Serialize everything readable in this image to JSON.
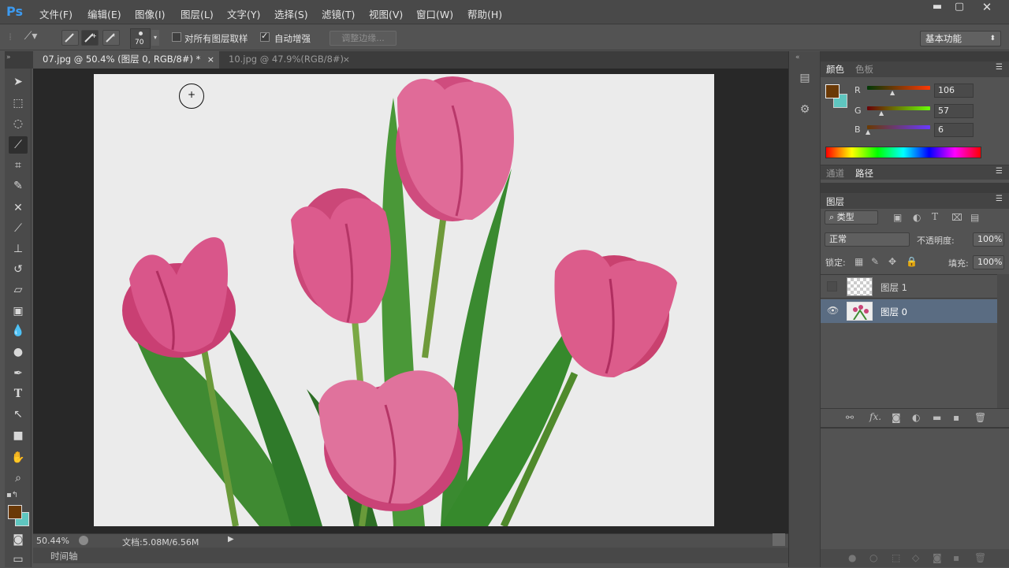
{
  "app": {
    "logo": "Ps"
  },
  "menu": [
    "文件(F)",
    "编辑(E)",
    "图像(I)",
    "图层(L)",
    "文字(Y)",
    "选择(S)",
    "滤镜(T)",
    "视图(V)",
    "窗口(W)",
    "帮助(H)"
  ],
  "options": {
    "brush_size": "70",
    "sample_all_layers": "对所有图层取样",
    "auto_enhance": "自动增强",
    "refine_edge": "调整边缘...",
    "workspace": "基本功能"
  },
  "tabs": [
    {
      "label": "07.jpg @ 50.4% (图层 0, RGB/8#) *",
      "close": "×"
    },
    {
      "label": "10.jpg @ 47.9%(RGB/8#)",
      "close": "×"
    }
  ],
  "status": {
    "zoom": "50.44%",
    "doc": "文档:5.08M/6.56M",
    "timeline": "时间轴"
  },
  "color_panel": {
    "tabs": [
      "颜色",
      "色板"
    ],
    "r_label": "R",
    "g_label": "G",
    "b_label": "B",
    "r": "106",
    "g": "57",
    "b": "6",
    "fg": "#6a3906",
    "bg": "#5fc6c0"
  },
  "paths_panel": {
    "tabs": [
      "通道",
      "路径"
    ]
  },
  "layers_panel": {
    "title": "图层",
    "filter": "类型",
    "blend": "正常",
    "opacity_label": "不透明度:",
    "opacity": "100%",
    "lock_label": "锁定:",
    "fill_label": "填充:",
    "fill": "100%",
    "layers": [
      {
        "name": "图层 1",
        "visible": false
      },
      {
        "name": "图层 0",
        "visible": true,
        "selected": true
      }
    ]
  }
}
